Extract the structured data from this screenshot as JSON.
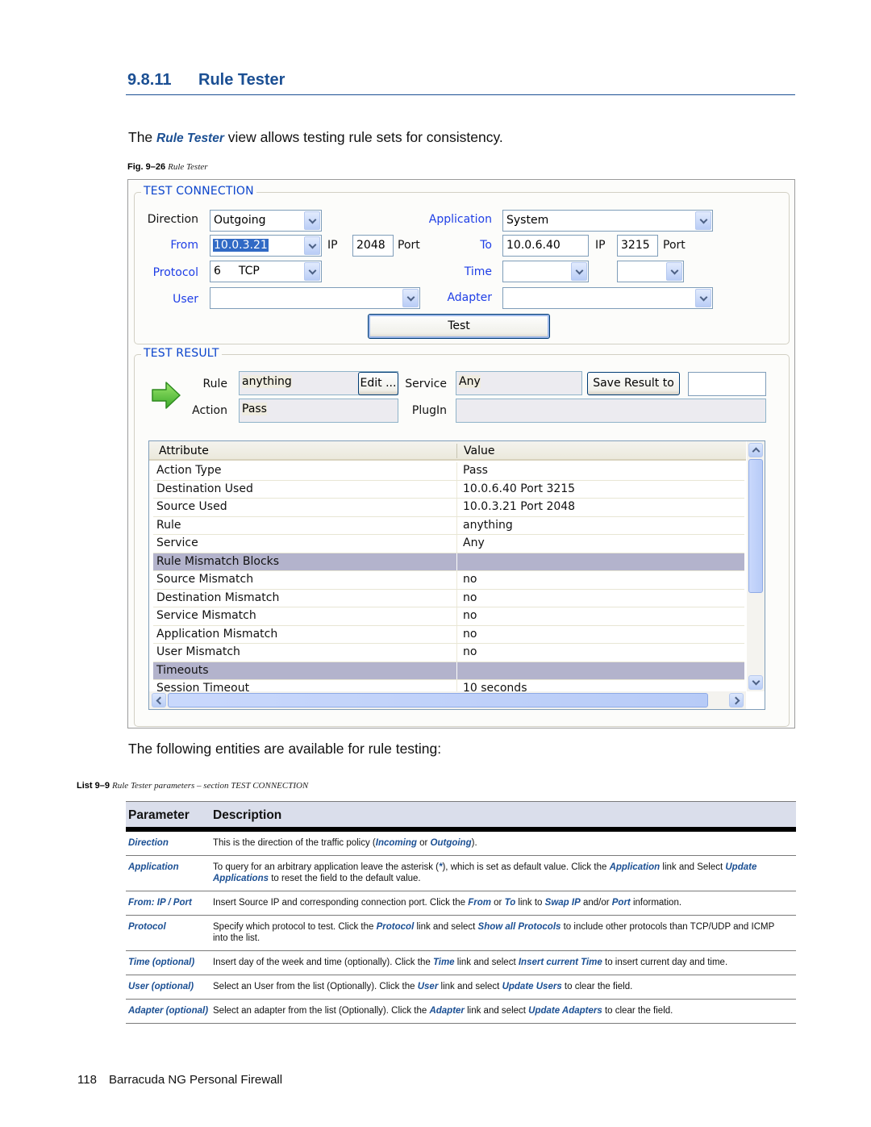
{
  "section": {
    "number": "9.8.11",
    "title": "Rule Tester"
  },
  "intro": {
    "prefix": "The ",
    "emphasis": "Rule Tester",
    "suffix": " view allows testing rule sets for consistency."
  },
  "figure_caption": {
    "label": "Fig. 9–26",
    "text": "Rule Tester"
  },
  "test_connection": {
    "legend": "TEST CONNECTION",
    "direction": {
      "label": "Direction",
      "value": "Outgoing"
    },
    "from": {
      "label": "From",
      "ip": "10.0.3.21",
      "ip_label": "IP",
      "port": "2048",
      "port_label": "Port"
    },
    "protocol": {
      "label": "Protocol",
      "number": "6",
      "name": "TCP"
    },
    "user": {
      "label": "User",
      "value": ""
    },
    "application": {
      "label": "Application",
      "value": "System"
    },
    "to": {
      "label": "To",
      "ip": "10.0.6.40",
      "ip_label": "IP",
      "port": "3215",
      "port_label": "Port"
    },
    "time": {
      "label": "Time",
      "day": "",
      "time": ""
    },
    "adapter": {
      "label": "Adapter",
      "value": ""
    },
    "test_button": "Test"
  },
  "test_result": {
    "legend": "TEST RESULT",
    "rule": {
      "label": "Rule",
      "value": "anything"
    },
    "edit_button": "Edit ...",
    "service": {
      "label": "Service",
      "value": "Any"
    },
    "save_button": "Save Result  to",
    "save_target": "",
    "action": {
      "label": "Action",
      "value": "Pass"
    },
    "plugin": {
      "label": "PlugIn",
      "value": ""
    },
    "colors": {
      "arrow": "#4fc132",
      "group_row": "#b3b3cc"
    },
    "grid": {
      "columns": [
        "Attribute",
        "Value"
      ],
      "rows": [
        {
          "attribute": "Action Type",
          "value": "Pass",
          "group": false
        },
        {
          "attribute": "Destination Used",
          "value": "10.0.6.40 Port 3215",
          "group": false
        },
        {
          "attribute": "Source Used",
          "value": "10.0.3.21 Port 2048",
          "group": false
        },
        {
          "attribute": "Rule",
          "value": "anything",
          "group": false
        },
        {
          "attribute": "Service",
          "value": "Any",
          "group": false
        },
        {
          "attribute": "Rule Mismatch Blocks",
          "value": "",
          "group": true
        },
        {
          "attribute": "Source Mismatch",
          "value": "no",
          "group": false
        },
        {
          "attribute": "Destination Mismatch",
          "value": "no",
          "group": false
        },
        {
          "attribute": "Service Mismatch",
          "value": "no",
          "group": false
        },
        {
          "attribute": "Application Mismatch",
          "value": "no",
          "group": false
        },
        {
          "attribute": "User Mismatch",
          "value": "no",
          "group": false
        },
        {
          "attribute": "Timeouts",
          "value": "",
          "group": true
        },
        {
          "attribute": "Session Timeout",
          "value": "10 seconds",
          "group": false
        }
      ]
    }
  },
  "following_text": "The following entities are available for rule testing:",
  "list_caption": {
    "label": "List 9–9",
    "text": "Rule Tester parameters – section TEST CONNECTION"
  },
  "param_table": {
    "headers": {
      "parameter": "Parameter",
      "description": "Description"
    },
    "rows": [
      {
        "name": "Direction",
        "desc": [
          {
            "t": "This is the direction of the traffic policy ("
          },
          {
            "t": "Incoming",
            "em": true
          },
          {
            "t": " or "
          },
          {
            "t": "Outgoing",
            "em": true
          },
          {
            "t": ")."
          }
        ]
      },
      {
        "name": "Application",
        "desc": [
          {
            "t": "To query for an arbitrary application leave the asterisk ("
          },
          {
            "t": "*",
            "em": true
          },
          {
            "t": "), which is set as default value. Click the "
          },
          {
            "t": "Application",
            "em": true
          },
          {
            "t": " link and Select "
          },
          {
            "t": "Update Applications",
            "em": true
          },
          {
            "t": " to reset the field to the default value."
          }
        ]
      },
      {
        "name": "From: IP / Port",
        "desc": [
          {
            "t": "Insert Source IP and corresponding connection port. Click the "
          },
          {
            "t": "From",
            "em": true
          },
          {
            "t": " or "
          },
          {
            "t": "To",
            "em": true
          },
          {
            "t": " link to "
          },
          {
            "t": "Swap IP",
            "em": true
          },
          {
            "t": " and/or "
          },
          {
            "t": "Port",
            "em": true
          },
          {
            "t": " information."
          }
        ]
      },
      {
        "name": "Protocol",
        "desc": [
          {
            "t": "Specify which protocol to test. Click the "
          },
          {
            "t": "Protocol",
            "em": true
          },
          {
            "t": " link and select "
          },
          {
            "t": "Show all Protocols",
            "em": true
          },
          {
            "t": " to include other protocols than TCP/UDP and ICMP into the list."
          }
        ]
      },
      {
        "name": "Time (optional)",
        "desc": [
          {
            "t": "Insert day of the week and time (optionally). Click the "
          },
          {
            "t": "Time",
            "em": true
          },
          {
            "t": " link and select "
          },
          {
            "t": "Insert current Time",
            "em": true
          },
          {
            "t": " to insert current day and time."
          }
        ]
      },
      {
        "name": "User (optional)",
        "desc": [
          {
            "t": "Select an User from the list (Optionally). Click the "
          },
          {
            "t": "User",
            "em": true
          },
          {
            "t": " link and select "
          },
          {
            "t": "Update Users",
            "em": true
          },
          {
            "t": " to clear the field."
          }
        ]
      },
      {
        "name": "Adapter (optional)",
        "desc": [
          {
            "t": "Select an adapter from the list (Optionally). Click the "
          },
          {
            "t": "Adapter",
            "em": true
          },
          {
            "t": " link and select "
          },
          {
            "t": "Update Adapters",
            "em": true
          },
          {
            "t": " to clear the field."
          }
        ]
      }
    ]
  },
  "footer": {
    "page_number": "118",
    "title": "Barracuda NG Personal Firewall"
  },
  "colors": {
    "heading_blue": "#1b4f93",
    "link_blue": "#1e3ee6",
    "legend_blue": "#0a43cc",
    "table_header_bg": "#dadeeb"
  }
}
